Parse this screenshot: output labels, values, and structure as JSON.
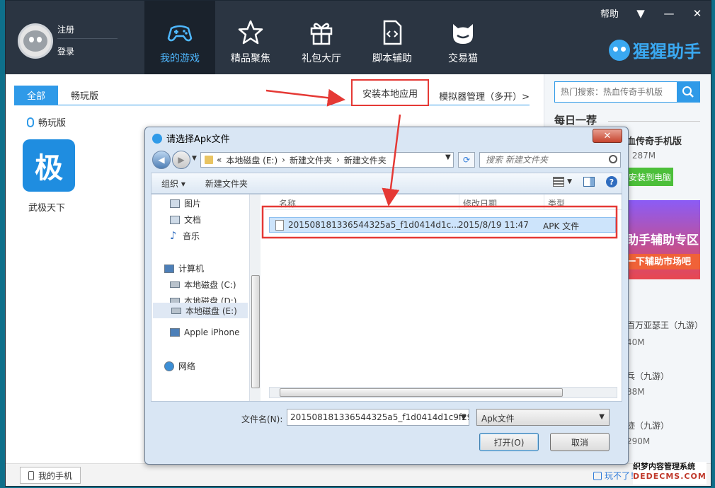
{
  "header": {
    "register": "注册",
    "login": "登录",
    "help": "帮助",
    "brand": "猩猩助手",
    "nav": [
      {
        "label": "我的游戏",
        "icon": "gamepad-icon"
      },
      {
        "label": "精品聚焦",
        "icon": "star-icon"
      },
      {
        "label": "礼包大厅",
        "icon": "gift-icon"
      },
      {
        "label": "脚本辅助",
        "icon": "script-file-icon"
      },
      {
        "label": "交易猫",
        "icon": "cat-icon"
      }
    ]
  },
  "main": {
    "tabs": [
      "全部",
      "畅玩版"
    ],
    "install_local": "安装本地应用",
    "emulator_manage": "模拟器管理（多开）>",
    "section_label": "畅玩版",
    "game_tile_char": "极",
    "game_name": "武极天下"
  },
  "sidebar": {
    "search_placeholder": "热门搜索：热血传奇手机版",
    "daily": "每日一荐",
    "featured_name": "血传奇手机版",
    "featured_meta": "| 287M",
    "featured_install": "安装到电脑",
    "banner_line1": "助手辅助专区",
    "banner_line2": "一下辅助市场吧",
    "ranks": [
      {
        "name": "百万亚瑟王（九游）",
        "size": "40M"
      },
      {
        "name": "乓（九游）",
        "size": "88M"
      },
      {
        "name": "迹（九游）",
        "size": "290M"
      }
    ]
  },
  "bottom": {
    "my_phone": "我的手机",
    "cant_play": "玩不了！速"
  },
  "dialog": {
    "title": "请选择Apk文件",
    "address": [
      "«",
      "本地磁盘 (E:)",
      "›",
      "新建文件夹",
      "›",
      "新建文件夹"
    ],
    "search_placeholder": "搜索 新建文件夹",
    "toolbar": {
      "organize": "组织 ▾",
      "new_folder": "新建文件夹"
    },
    "tree": [
      {
        "label": "图片",
        "icon": "pictures-icon"
      },
      {
        "label": "文档",
        "icon": "documents-icon"
      },
      {
        "label": "音乐",
        "icon": "music-icon"
      },
      {
        "label": "计算机",
        "icon": "computer-icon"
      },
      {
        "label": "本地磁盘 (C:)",
        "icon": "drive-icon"
      },
      {
        "label": "本地磁盘 (D:)",
        "icon": "drive-icon"
      },
      {
        "label": "本地磁盘 (E:)",
        "icon": "drive-icon"
      },
      {
        "label": "Apple iPhone",
        "icon": "iphone-icon"
      },
      {
        "label": "网络",
        "icon": "network-icon"
      }
    ],
    "columns": {
      "name": "名称",
      "date": "修改日期",
      "type": "类型"
    },
    "file": {
      "name": "201508181336544325a5_f1d0414d1c...",
      "date": "2015/8/19 11:47",
      "type": "APK 文件"
    },
    "filename_label": "文件名(N):",
    "filename_value": "201508181336544325a5_f1d0414d1c9f29",
    "filetype": "Apk文件",
    "open": "打开(O)",
    "cancel": "取消"
  },
  "watermark": {
    "line1": "织梦内容管理系统",
    "line2": "DEDECMS.COM"
  },
  "colors": {
    "accent": "#2f9ae8",
    "header_bg": "#2b3542",
    "highlight_red": "#e53935"
  }
}
